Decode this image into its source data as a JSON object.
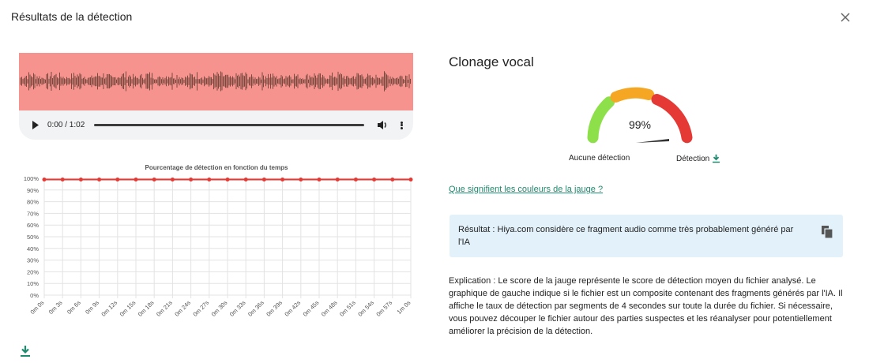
{
  "modal": {
    "title": "Résultats de la détection"
  },
  "player": {
    "time": "0:00 / 1:02",
    "progress": 0
  },
  "chart_data": {
    "type": "line",
    "title": "Pourcentage de détection en fonction du temps",
    "categories": [
      "0m 0s",
      "0m 3s",
      "0m 6s",
      "0m 9s",
      "0m 12s",
      "0m 15s",
      "0m 18s",
      "0m 21s",
      "0m 24s",
      "0m 27s",
      "0m 30s",
      "0m 33s",
      "0m 36s",
      "0m 39s",
      "0m 42s",
      "0m 45s",
      "0m 48s",
      "0m 51s",
      "0m 54s",
      "0m 57s",
      "1m 0s"
    ],
    "values": [
      99,
      99,
      99,
      99,
      99,
      99,
      99,
      99,
      99,
      99,
      99,
      99,
      99,
      99,
      99,
      99,
      99,
      99,
      99,
      99,
      99
    ],
    "yticks": [
      "100%",
      "90%",
      "80%",
      "70%",
      "60%",
      "50%",
      "40%",
      "30%",
      "20%",
      "10%",
      "0%"
    ],
    "ylim": [
      0,
      100
    ],
    "color": "#e53935",
    "grid": true
  },
  "detection": {
    "title": "Clonage vocal",
    "score": 99,
    "score_label": "99%",
    "left_label": "Aucune détection",
    "right_label": "Détection",
    "colors": {
      "low": "#8ee04a",
      "mid": "#f5a623",
      "high": "#e53935",
      "accent": "#1e8a6e"
    }
  },
  "help_link": "Que signifient les couleurs de la jauge ?",
  "result": {
    "text": "Résultat : Hiya.com considère ce fragment audio comme très probablement généré par l'IA"
  },
  "explanation": "Explication : Le score de la jauge représente le score de détection moyen du fichier analysé. Le graphique de gauche indique si le fichier est un composite contenant des fragments générés par l'IA. Il affiche le taux de détection par segments de 4 secondes sur toute la durée du fichier. Si nécessaire, vous pouvez découper le fichier autour des parties suspectes et les réanalyser pour potentiellement améliorer la précision de la détection."
}
